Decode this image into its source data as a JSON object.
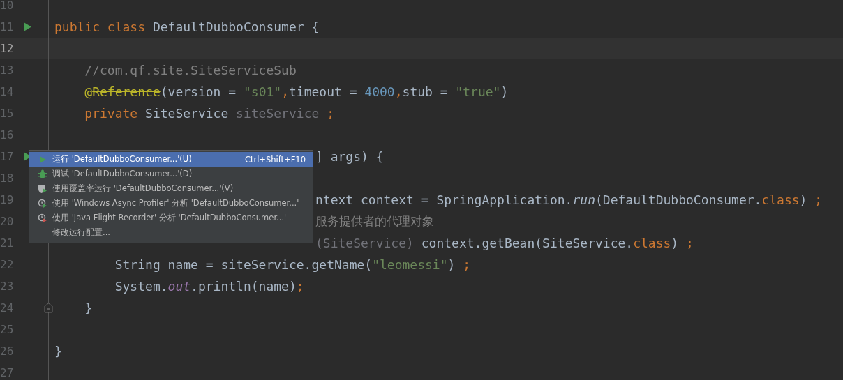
{
  "editor": {
    "lines": [
      {
        "number": "10",
        "current": false,
        "run_marker": false,
        "fold": false
      },
      {
        "number": "11",
        "current": false,
        "run_marker": true,
        "fold": false,
        "tokens": [
          {
            "text": "public class ",
            "kind": "keyword"
          },
          {
            "text": "DefaultDubboConsumer {",
            "kind": "plain"
          }
        ]
      },
      {
        "number": "12",
        "current": true,
        "run_marker": false,
        "fold": false
      },
      {
        "number": "13",
        "current": false,
        "run_marker": false,
        "fold": false,
        "tokens": [
          {
            "text": "    //com.qf.site.SiteServiceSub",
            "kind": "comment"
          }
        ]
      },
      {
        "number": "14",
        "current": false,
        "run_marker": false,
        "fold": false,
        "tokens": [
          {
            "text": "    @",
            "kind": "annotation"
          },
          {
            "text": "Reference",
            "kind": "deprecated"
          },
          {
            "text": "(version = ",
            "kind": "plain"
          },
          {
            "text": "\"s01\"",
            "kind": "string"
          },
          {
            "text": ",",
            "kind": "keyword"
          },
          {
            "text": "timeout = ",
            "kind": "plain"
          },
          {
            "text": "4000",
            "kind": "number"
          },
          {
            "text": ",",
            "kind": "keyword"
          },
          {
            "text": "stub = ",
            "kind": "plain"
          },
          {
            "text": "\"true\"",
            "kind": "string"
          },
          {
            "text": ")",
            "kind": "plain"
          }
        ]
      },
      {
        "number": "15",
        "current": false,
        "run_marker": false,
        "fold": false,
        "tokens": [
          {
            "text": "    private ",
            "kind": "keyword"
          },
          {
            "text": "SiteService ",
            "kind": "plain"
          },
          {
            "text": "siteService",
            "kind": "unused"
          },
          {
            "text": " ;",
            "kind": "keyword"
          }
        ]
      },
      {
        "number": "16",
        "current": false,
        "run_marker": false,
        "fold": false
      },
      {
        "number": "17",
        "current": false,
        "run_marker": true,
        "fold": false,
        "behind_menu": true,
        "tokens": [
          {
            "text": "] args) {",
            "kind": "plain"
          }
        ]
      },
      {
        "number": "18",
        "current": false,
        "run_marker": false
      },
      {
        "number": "19",
        "current": false,
        "run_marker": false,
        "fold": false,
        "behind_menu": true,
        "tokens": [
          {
            "text": "ntext context = SpringApplication.",
            "kind": "plain"
          },
          {
            "text": "run",
            "kind": "italic"
          },
          {
            "text": "(DefaultDubboConsumer.",
            "kind": "plain"
          },
          {
            "text": "class",
            "kind": "keyword"
          },
          {
            "text": ") ",
            "kind": "plain"
          },
          {
            "text": ";",
            "kind": "keyword"
          }
        ]
      },
      {
        "number": "20",
        "current": false,
        "run_marker": false,
        "fold": false,
        "behind_menu": true,
        "tokens": [
          {
            "text": "服务提供者的代理对象",
            "kind": "cjk-comment"
          }
        ]
      },
      {
        "number": "21",
        "current": false,
        "run_marker": false,
        "fold": false,
        "behind_menu": true,
        "tokens": [
          {
            "text": "(SiteService)",
            "kind": "unused"
          },
          {
            "text": " context.getBean(SiteService.",
            "kind": "plain"
          },
          {
            "text": "class",
            "kind": "keyword"
          },
          {
            "text": ") ",
            "kind": "plain"
          },
          {
            "text": ";",
            "kind": "keyword"
          }
        ]
      },
      {
        "number": "22",
        "current": false,
        "run_marker": false,
        "fold": false,
        "tokens": [
          {
            "text": "        String name = siteService.getName(",
            "kind": "plain"
          },
          {
            "text": "\"leomessi\"",
            "kind": "string"
          },
          {
            "text": ") ",
            "kind": "plain"
          },
          {
            "text": ";",
            "kind": "keyword"
          }
        ]
      },
      {
        "number": "23",
        "current": false,
        "run_marker": false,
        "fold": false,
        "tokens": [
          {
            "text": "        System.",
            "kind": "plain"
          },
          {
            "text": "out",
            "kind": "field"
          },
          {
            "text": ".println(name)",
            "kind": "plain"
          },
          {
            "text": ";",
            "kind": "keyword"
          }
        ]
      },
      {
        "number": "24",
        "current": false,
        "run_marker": false,
        "fold": true,
        "tokens": [
          {
            "text": "    }",
            "kind": "plain"
          }
        ]
      },
      {
        "number": "25",
        "current": false,
        "run_marker": false,
        "fold": false
      },
      {
        "number": "26",
        "current": false,
        "run_marker": false,
        "fold": false,
        "tokens": [
          {
            "text": "}",
            "kind": "plain"
          }
        ]
      },
      {
        "number": "27",
        "current": false,
        "run_marker": false,
        "fold": false
      }
    ]
  },
  "context_menu": {
    "items": [
      {
        "kind": "run",
        "label": "运行 'DefaultDubboConsumer...'(U)",
        "shortcut": "Ctrl+Shift+F10",
        "selected": true
      },
      {
        "kind": "debug",
        "label": "调试 'DefaultDubboConsumer...'(D)",
        "selected": false
      },
      {
        "kind": "coverage",
        "label": "使用覆盖率运行  'DefaultDubboConsumer...'(V)",
        "selected": false
      },
      {
        "kind": "profiler",
        "label": "使用 'Windows Async Profiler' 分析  'DefaultDubboConsumer...'",
        "selected": false
      },
      {
        "kind": "recorder",
        "label": "使用 'Java Flight Recorder' 分析  'DefaultDubboConsumer...'",
        "selected": false
      },
      {
        "kind": "edit",
        "label": "修改运行配置...",
        "selected": false
      }
    ]
  }
}
